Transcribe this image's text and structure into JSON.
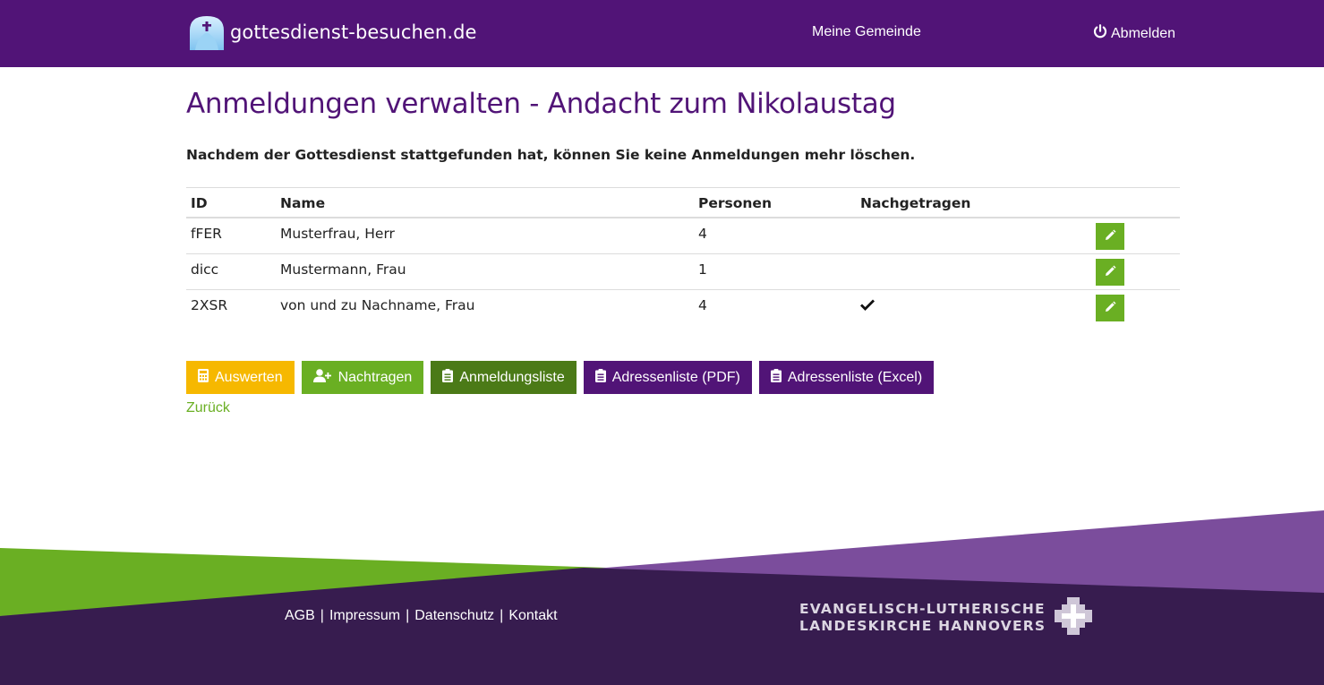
{
  "header": {
    "logo_text": "gottesdienst-besuchen.de",
    "nav_gemeinde": "Meine Gemeinde",
    "nav_logout": "Abmelden"
  },
  "page": {
    "title": "Anmeldungen verwalten - Andacht zum Nikolaustag",
    "notice": "Nachdem der Gottesdienst stattgefunden hat, können Sie keine Anmeldungen mehr löschen."
  },
  "table": {
    "columns": [
      "ID",
      "Name",
      "Personen",
      "Nachgetragen"
    ],
    "rows": [
      {
        "id": "fFER",
        "name": "Musterfrau, Herr",
        "personen": "4",
        "nachgetragen": false
      },
      {
        "id": "dicc",
        "name": "Mustermann, Frau",
        "personen": "1",
        "nachgetragen": false
      },
      {
        "id": "2XSR",
        "name": "von und zu Nachname, Frau",
        "personen": "4",
        "nachgetragen": true
      }
    ]
  },
  "actions": {
    "auswerten": "Auswerten",
    "nachtragen": "Nachtragen",
    "anmeldungsliste": "Anmeldungsliste",
    "adressenliste_pdf": "Adressenliste (PDF)",
    "adressenliste_excel": "Adressenliste (Excel)"
  },
  "back_link": "Zurück",
  "footer": {
    "agb": "AGB",
    "impressum": "Impressum",
    "datenschutz": "Datenschutz",
    "kontakt": "Kontakt",
    "separator": "|",
    "church_line1": "EVANGELISCH-LUTHERISCHE",
    "church_line2": "LANDESKIRCHE HANNOVERS"
  },
  "colors": {
    "header_purple": "#511477",
    "green": "#6aaf23",
    "dark_green": "#4b7a17",
    "yellow": "#f6b800",
    "footer_dark": "#371c4f",
    "footer_lilac": "#7b4d9c"
  }
}
